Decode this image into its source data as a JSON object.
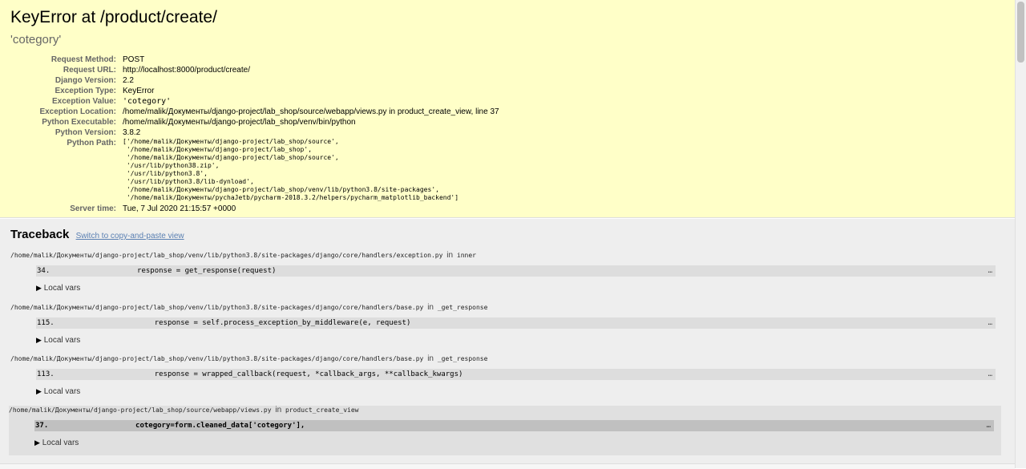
{
  "summary": {
    "title": "KeyError at /product/create/",
    "exception_value": "'cotegory'",
    "meta": [
      {
        "label": "Request Method:",
        "value": "POST",
        "mono": false
      },
      {
        "label": "Request URL:",
        "value": "http://localhost:8000/product/create/",
        "mono": false
      },
      {
        "label": "Django Version:",
        "value": "2.2",
        "mono": false
      },
      {
        "label": "Exception Type:",
        "value": "KeyError",
        "mono": false
      },
      {
        "label": "Exception Value:",
        "value": "'cotegory'",
        "mono": true
      },
      {
        "label": "Exception Location:",
        "value": "/home/malik/Документы/django-project/lab_shop/source/webapp/views.py in product_create_view, line 37",
        "mono": false
      },
      {
        "label": "Python Executable:",
        "value": "/home/malik/Документы/django-project/lab_shop/venv/bin/python",
        "mono": false
      },
      {
        "label": "Python Version:",
        "value": "3.8.2",
        "mono": false
      }
    ],
    "python_path_label": "Python Path:",
    "python_path": [
      "['/home/malik/Документы/django-project/lab_shop/source',",
      " '/home/malik/Документы/django-project/lab_shop',",
      " '/home/malik/Документы/django-project/lab_shop/source',",
      " '/usr/lib/python38.zip',",
      " '/usr/lib/python3.8',",
      " '/usr/lib/python3.8/lib-dynload',",
      " '/home/malik/Документы/django-project/lab_shop/venv/lib/python3.8/site-packages',",
      " '/home/malik/Документы/pychaJetb/pycharm-2018.3.2/helpers/pycharm_matplotlib_backend']"
    ],
    "server_time_label": "Server time:",
    "server_time": "Tue, 7 Jul 2020 21:15:57 +0000"
  },
  "traceback": {
    "heading": "Traceback",
    "switch_link": "Switch to copy-and-paste view",
    "in_word": "in",
    "local_vars_label": "Local vars",
    "dots": "…",
    "frames": [
      {
        "file": "/home/malik/Документы/django-project/lab_shop/venv/lib/python3.8/site-packages/django/core/handlers/exception.py",
        "func": "inner",
        "lineno": "34.",
        "code": "            response = get_response(request)",
        "user": false
      },
      {
        "file": "/home/malik/Документы/django-project/lab_shop/venv/lib/python3.8/site-packages/django/core/handlers/base.py",
        "func": "_get_response",
        "lineno": "115.",
        "code": "                response = self.process_exception_by_middleware(e, request)",
        "user": false
      },
      {
        "file": "/home/malik/Документы/django-project/lab_shop/venv/lib/python3.8/site-packages/django/core/handlers/base.py",
        "func": "_get_response",
        "lineno": "113.",
        "code": "                response = wrapped_callback(request, *callback_args, **callback_kwargs)",
        "user": false
      },
      {
        "file": "/home/malik/Документы/django-project/lab_shop/source/webapp/views.py",
        "func": "product_create_view",
        "lineno": "37.",
        "code": "            cotegory=form.cleaned_data['cotegory'],",
        "user": true
      }
    ]
  }
}
